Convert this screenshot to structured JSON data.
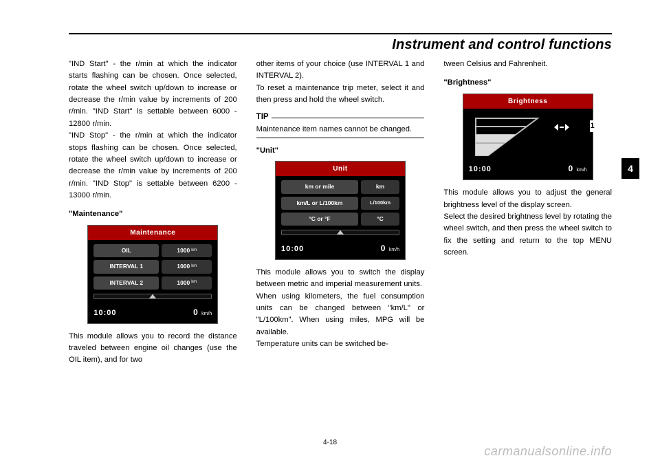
{
  "header": {
    "title": "Instrument and control functions"
  },
  "tab": {
    "num": "4"
  },
  "col1": {
    "p1": "\"IND Start\" - the r/min at which the indicator starts flashing can be chosen. Once selected, rotate the wheel switch up/down to increase or decrease the r/min value by increments of 200 r/min. \"IND Start\" is settable between 6000 - 12800 r/min.",
    "p2": "\"IND Stop\" - the r/min at which the indicator stops flashing can be chosen. Once selected, rotate the wheel switch up/down to increase or decrease the r/min value by increments of 200 r/min. \"IND Stop\" is settable between 6200 - 13000 r/min.",
    "sub": "\"Maintenance\"",
    "p3": "This module allows you to record the distance traveled between engine oil changes (use the OIL item), and for two"
  },
  "maint_screen": {
    "title": "Maintenance",
    "rows": [
      {
        "label": "OIL",
        "value": "1000",
        "unit": "km"
      },
      {
        "label": "INTERVAL 1",
        "value": "1000",
        "unit": "km"
      },
      {
        "label": "INTERVAL 2",
        "value": "1000",
        "unit": "km"
      }
    ],
    "time": "10:00",
    "speed": "0",
    "speed_unit": "km/h"
  },
  "col2": {
    "p1": "other items of your choice (use INTERVAL 1 and INTERVAL 2).",
    "p2": "To reset a maintenance trip meter, select it and then press and hold the wheel switch.",
    "tip_label": "TIP",
    "tip_text": "Maintenance item names cannot be changed.",
    "sub": "\"Unit\"",
    "p3": "This module allows you to switch the display between metric and imperial measurement units.",
    "p4": "When using kilometers, the fuel consumption units can be changed between \"km/L\" or \"L/100km\". When using miles, MPG will be available.",
    "p5": "Temperature units can be switched be-"
  },
  "unit_screen": {
    "title": "Unit",
    "rows": [
      {
        "label": "km or mile",
        "value": "km"
      },
      {
        "label": "km/L or L/100km",
        "value": "L/100km"
      },
      {
        "label": "°C or °F",
        "value": "°C"
      }
    ],
    "time": "10:00",
    "speed": "0",
    "speed_unit": "km/h"
  },
  "col3": {
    "p1": "tween Celsius and Fahrenheit.",
    "sub": "\"Brightness\"",
    "p2": "This module allows you to adjust the general brightness level of the display screen.",
    "p3": "Select the desired brightness level by rotating the wheel switch, and then press the wheel switch to fix the setting and return to the top MENU screen."
  },
  "bright_screen": {
    "title": "Brightness",
    "callout": "1",
    "time": "10:00",
    "speed": "0",
    "speed_unit": "km/h"
  },
  "footer": {
    "pgnum": "4-18",
    "watermark": "carmanualsonline.info"
  }
}
